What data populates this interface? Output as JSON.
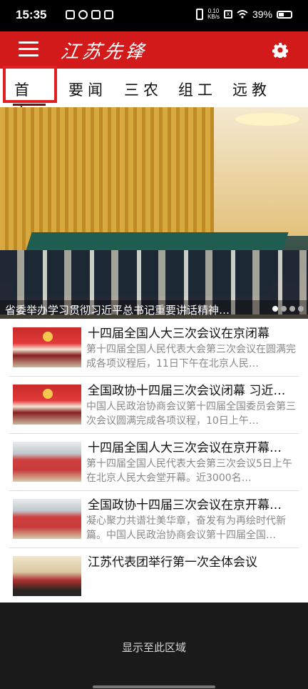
{
  "status_bar": {
    "time": "15:35",
    "speed": "0.10\nKB/s",
    "battery": "39%"
  },
  "app": {
    "logo": "江苏先锋"
  },
  "tabs": [
    {
      "label": "首页",
      "active": true
    },
    {
      "label": "要闻"
    },
    {
      "label": "三农"
    },
    {
      "label": "组工"
    },
    {
      "label": "远教"
    }
  ],
  "banner": {
    "caption": "省委举办学习贯彻习近平总书记重要讲话精神…"
  },
  "news": [
    {
      "title": "十四届全国人大三次会议在京闭幕",
      "desc": "第十四届全国人民代表大会第三次会议在圆满完成各项议程后，11日下午在北京人民…"
    },
    {
      "title": "全国政协十四届三次会议闭幕 习近…",
      "desc": "中国人民政治协商会议第十四届全国委员会第三次会议圆满完成各项议程，10日上午…"
    },
    {
      "title": "十四届全国人大三次会议在京开幕…",
      "desc": "第十四届全国人民代表大会第三次会议5日上午在北京人民大会堂开幕。近3000名…"
    },
    {
      "title": "全国政协十四届三次会议在京开幕…",
      "desc": "凝心聚力共谱壮美华章，奋发有为再绘时代新篇。中国人民政治协商会议第十四届全国…"
    },
    {
      "title": "江苏代表团举行第一次全体会议",
      "desc": ""
    }
  ],
  "footer": {
    "text": "显示至此区域"
  }
}
